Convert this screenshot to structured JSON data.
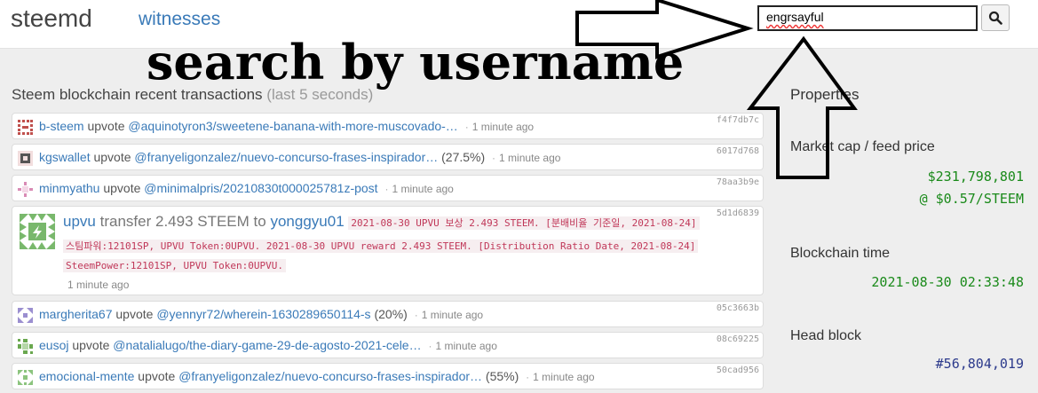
{
  "navbar": {
    "brand": "steemd",
    "nav_link": "witnesses",
    "search_value": "engrsayful",
    "search_icon": "magnifier-icon"
  },
  "annotation": {
    "text": "search by username"
  },
  "transactions": {
    "title": "Steem blockchain recent transactions",
    "title_suffix": "(last 5 seconds)",
    "items": [
      {
        "user": "b-steem",
        "op": "upvote",
        "target": "@aquinotyron3/sweetene-banana-with-more-muscovado-…",
        "pct": "",
        "time": "1 minute ago",
        "hash": "f4f7db7c"
      },
      {
        "user": "kgswallet",
        "op": "upvote",
        "target": "@franyeligonzalez/nuevo-concurso-frases-inspirador…",
        "pct": "(27.5%)",
        "time": "1 minute ago",
        "hash": "6017d768"
      },
      {
        "user": "minmyathu",
        "op": "upvote",
        "target": "@minimalpris/20210830t000025781z-post",
        "pct": "",
        "time": "1 minute ago",
        "hash": "78aa3b9e"
      },
      {
        "user": "margherita67",
        "op": "upvote",
        "target": "@yennyr72/wherein-1630289650114-s",
        "pct": "(20%)",
        "time": "1 minute ago",
        "hash": "05c3663b"
      },
      {
        "user": "eusoj",
        "op": "upvote",
        "target": "@natalialugo/the-diary-game-29-de-agosto-2021-cele…",
        "pct": "",
        "time": "1 minute ago",
        "hash": "08c69225"
      },
      {
        "user": "emocional-mente",
        "op": "upvote",
        "target": "@franyeligonzalez/nuevo-concurso-frases-inspirador…",
        "pct": "(55%)",
        "time": "1 minute ago",
        "hash": "50cad956"
      }
    ],
    "transfer": {
      "from": "upvu",
      "op": "transfer",
      "amount": "2.493 STEEM",
      "to_word": "to",
      "to": "yonggyu01",
      "memo1": "2021-08-30 UPVU 보상 2.493 STEEM. [분배비율 기준일, 2021-08-24]",
      "memo2": "스팀파워:12101SP, UPVU Token:0UPVU. 2021-08-30 UPVU reward 2.493 STEEM. [Distribution Ratio Date, 2021-08-24]",
      "memo3": "SteemPower:12101SP, UPVU Token:0UPVU.",
      "time": "1 minute ago",
      "hash": "5d1d6839"
    }
  },
  "properties": {
    "title": "Properties",
    "market_label": "Market cap / feed price",
    "market_cap": "$231,798,801",
    "feed_price": "@ $0.57/STEEM",
    "time_label": "Blockchain time",
    "time_value": "2021-08-30 02:33:48",
    "head_label": "Head block",
    "head_value": "#56,804,019"
  }
}
